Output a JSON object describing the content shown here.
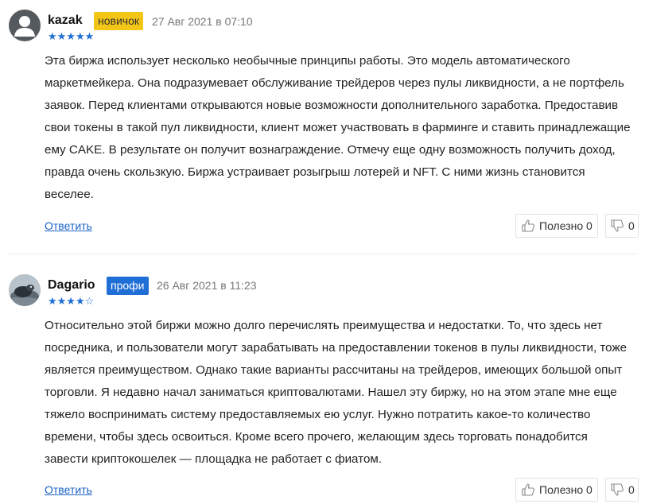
{
  "reviews": [
    {
      "username": "kazak",
      "badge": "новичок",
      "date": "27 Авг 2021 в 07:10",
      "rating": 5,
      "stars_filled": "★★★★★",
      "stars_empty": "",
      "text": "Эта биржа использует несколько необычные принципы работы. Это модель автоматического маркетмейкера. Она подразумевает обслуживание трейдеров через пулы ликвидности, а не портфель заявок. Перед клиентами открываются новые возможности дополнительного заработка. Предоставив свои токены в такой пул ликвидности, клиент может участвовать в фарминге и ставить принадлежащие ему CAKE. В результате он получит вознаграждение. Отмечу еще одну возможность получить доход, правда очень скользкую. Биржа устраивает розыгрыш лотерей и NFT. С ними жизнь становится веселее.",
      "reply_label": "Ответить",
      "useful_label": "Полезно 0",
      "dislike_count": "0"
    },
    {
      "username": "Dagario",
      "badge": "профи",
      "date": "26 Авг 2021 в 11:23",
      "rating": 4,
      "stars_filled": "★★★★",
      "stars_empty": "☆",
      "text": "Относительно этой биржи можно долго перечислять преимущества и недостатки. То, что здесь нет посредника, и пользователи могут зарабатывать на предоставлении токенов в пулы ликвидности, тоже является преимуществом. Однако такие варианты рассчитаны на трейдеров, имеющих большой опыт торговли. Я недавно начал заниматься криптовалютами. Нашел эту биржу, но на этом этапе мне еще тяжело воспринимать систему предоставляемых ею услуг. Нужно потратить какое-то количество времени, чтобы здесь освоиться. Кроме всего прочего, желающим здесь торговать понадобится завести криптокошелек — площадка не работает с фиатом.",
      "reply_label": "Ответить",
      "useful_label": "Полезно 0",
      "dislike_count": "0"
    }
  ]
}
